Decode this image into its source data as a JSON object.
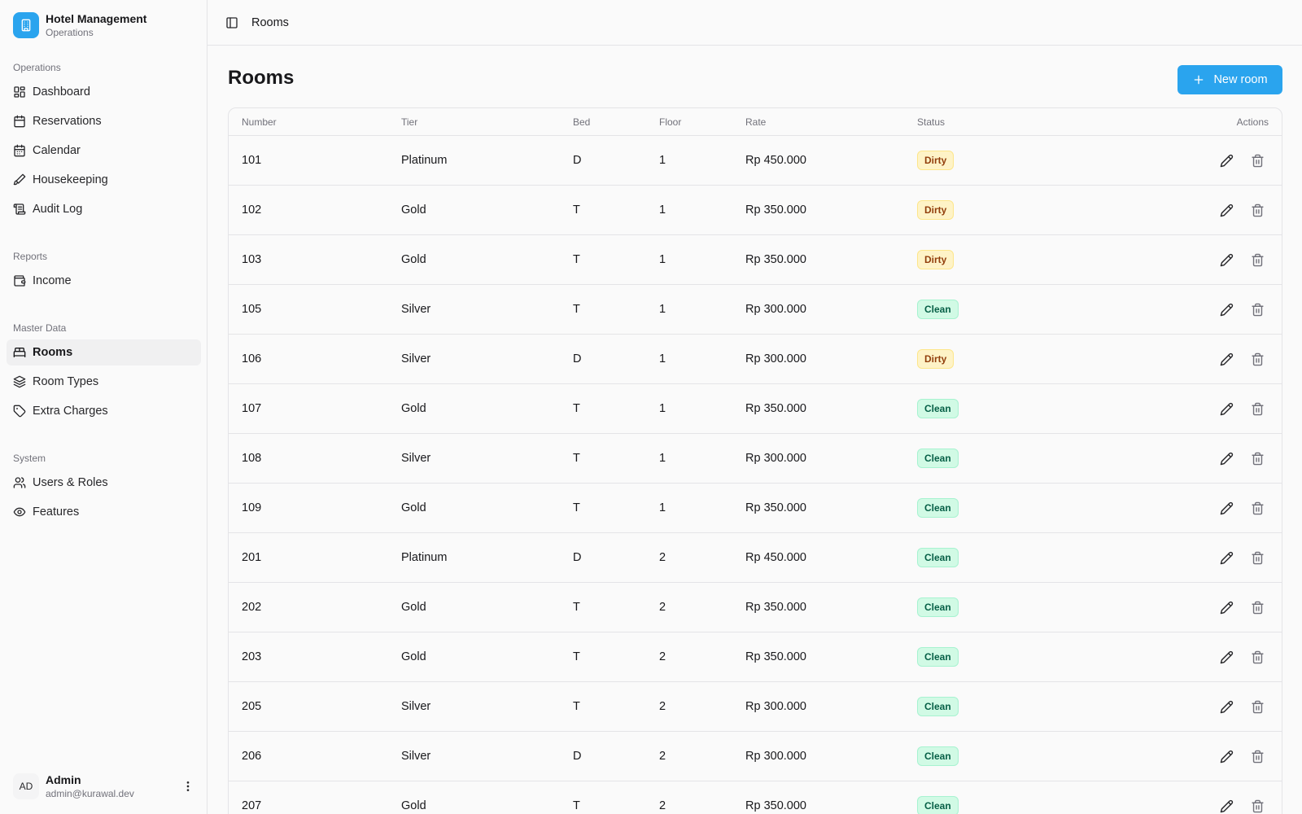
{
  "brand": {
    "title": "Hotel Management",
    "subtitle": "Operations",
    "logo_icon": "building-icon",
    "accent": "#2aa4ee"
  },
  "sidebar": {
    "groups": [
      {
        "label": "Operations",
        "items": [
          {
            "label": "Dashboard",
            "icon": "dashboard-icon"
          },
          {
            "label": "Reservations",
            "icon": "calendar-icon"
          },
          {
            "label": "Calendar",
            "icon": "calendar-days-icon"
          },
          {
            "label": "Housekeeping",
            "icon": "brush-icon"
          },
          {
            "label": "Audit Log",
            "icon": "scroll-icon"
          }
        ]
      },
      {
        "label": "Reports",
        "items": [
          {
            "label": "Income",
            "icon": "wallet-icon"
          }
        ]
      },
      {
        "label": "Master Data",
        "items": [
          {
            "label": "Rooms",
            "icon": "bed-icon",
            "active": true
          },
          {
            "label": "Room Types",
            "icon": "layers-icon"
          },
          {
            "label": "Extra Charges",
            "icon": "tag-icon"
          }
        ]
      },
      {
        "label": "System",
        "items": [
          {
            "label": "Users & Roles",
            "icon": "users-icon"
          },
          {
            "label": "Features",
            "icon": "eye-icon"
          }
        ]
      }
    ]
  },
  "user": {
    "initials": "AD",
    "name": "Admin",
    "email": "admin@kurawal.dev"
  },
  "header": {
    "breadcrumb": "Rooms"
  },
  "page": {
    "title": "Rooms",
    "new_button": "New room"
  },
  "table": {
    "columns": [
      "Number",
      "Tier",
      "Bed",
      "Floor",
      "Rate",
      "Status",
      "Actions"
    ],
    "rows": [
      {
        "number": "101",
        "tier": "Platinum",
        "bed": "D",
        "floor": "1",
        "rate": "Rp 450.000",
        "status": "Dirty"
      },
      {
        "number": "102",
        "tier": "Gold",
        "bed": "T",
        "floor": "1",
        "rate": "Rp 350.000",
        "status": "Dirty"
      },
      {
        "number": "103",
        "tier": "Gold",
        "bed": "T",
        "floor": "1",
        "rate": "Rp 350.000",
        "status": "Dirty"
      },
      {
        "number": "105",
        "tier": "Silver",
        "bed": "T",
        "floor": "1",
        "rate": "Rp 300.000",
        "status": "Clean"
      },
      {
        "number": "106",
        "tier": "Silver",
        "bed": "D",
        "floor": "1",
        "rate": "Rp 300.000",
        "status": "Dirty"
      },
      {
        "number": "107",
        "tier": "Gold",
        "bed": "T",
        "floor": "1",
        "rate": "Rp 350.000",
        "status": "Clean"
      },
      {
        "number": "108",
        "tier": "Silver",
        "bed": "T",
        "floor": "1",
        "rate": "Rp 300.000",
        "status": "Clean"
      },
      {
        "number": "109",
        "tier": "Gold",
        "bed": "T",
        "floor": "1",
        "rate": "Rp 350.000",
        "status": "Clean"
      },
      {
        "number": "201",
        "tier": "Platinum",
        "bed": "D",
        "floor": "2",
        "rate": "Rp 450.000",
        "status": "Clean"
      },
      {
        "number": "202",
        "tier": "Gold",
        "bed": "T",
        "floor": "2",
        "rate": "Rp 350.000",
        "status": "Clean"
      },
      {
        "number": "203",
        "tier": "Gold",
        "bed": "T",
        "floor": "2",
        "rate": "Rp 350.000",
        "status": "Clean"
      },
      {
        "number": "205",
        "tier": "Silver",
        "bed": "T",
        "floor": "2",
        "rate": "Rp 300.000",
        "status": "Clean"
      },
      {
        "number": "206",
        "tier": "Silver",
        "bed": "D",
        "floor": "2",
        "rate": "Rp 300.000",
        "status": "Clean"
      },
      {
        "number": "207",
        "tier": "Gold",
        "bed": "T",
        "floor": "2",
        "rate": "Rp 350.000",
        "status": "Clean"
      }
    ]
  },
  "status_colors": {
    "Dirty": "#92400e",
    "Clean": "#065f46"
  }
}
